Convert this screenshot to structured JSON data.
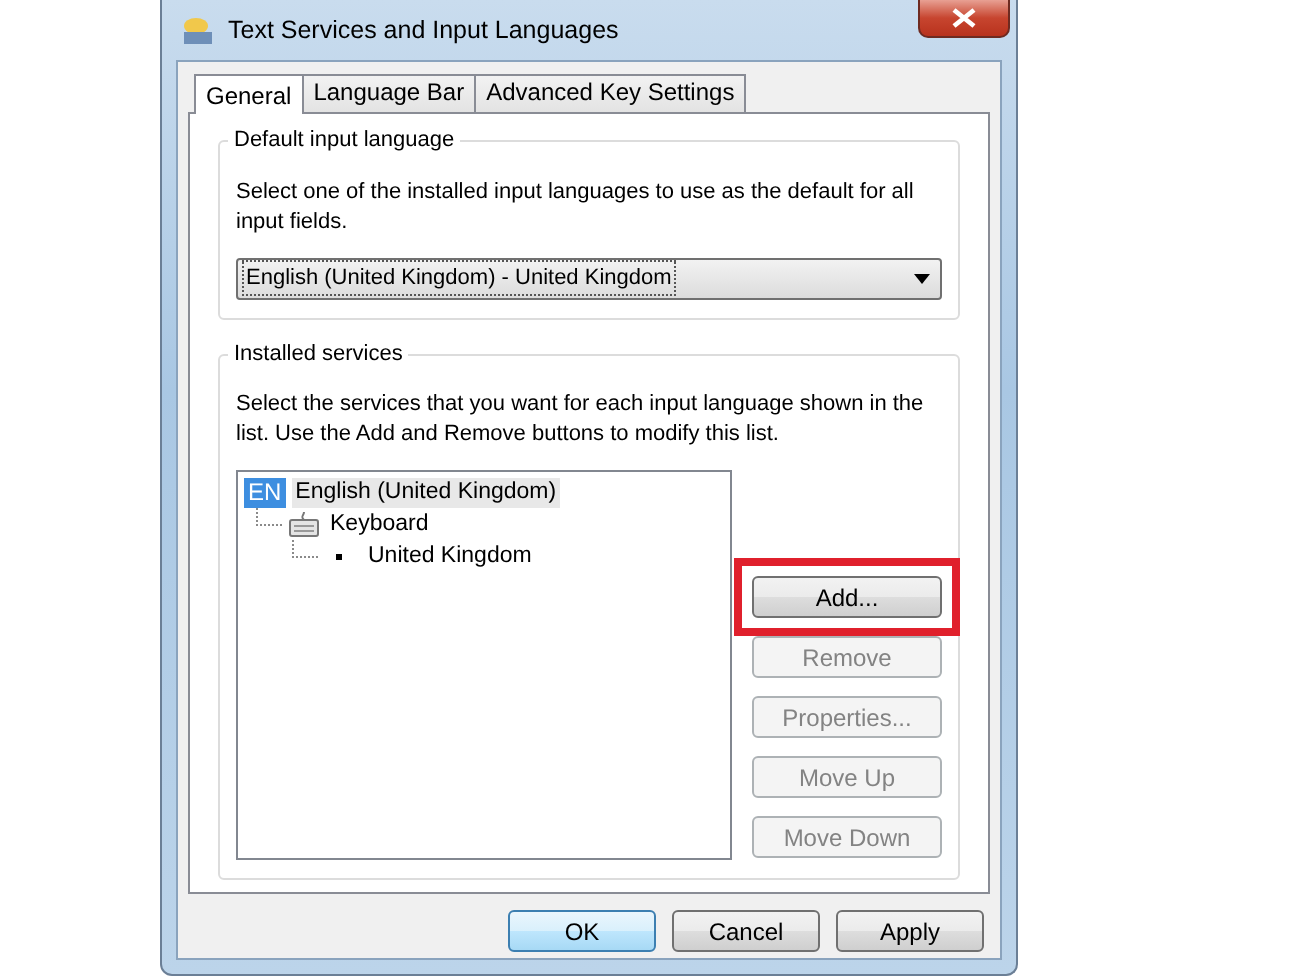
{
  "window": {
    "title": "Text Services and Input Languages"
  },
  "tabs": [
    {
      "label": "General",
      "selected": true
    },
    {
      "label": "Language Bar",
      "selected": false
    },
    {
      "label": "Advanced Key Settings",
      "selected": false
    }
  ],
  "default_input_language": {
    "legend": "Default input language",
    "description": "Select one of the installed input languages to use as the default for all input fields.",
    "dropdown": {
      "value": "English (United Kingdom) - United Kingdom"
    }
  },
  "installed_services": {
    "legend": "Installed services",
    "description": "Select the services that you want for each input language shown in the list. Use the Add and Remove buttons to modify this list.",
    "tree": [
      {
        "kind": "language",
        "badge": "EN",
        "label": "English (United Kingdom)",
        "selected": true,
        "children": [
          {
            "kind": "keyboard",
            "label": "Keyboard",
            "selected": false,
            "children": [
              {
                "kind": "layout",
                "label": "United Kingdom",
                "selected": false
              }
            ]
          }
        ]
      }
    ],
    "buttons": [
      {
        "label": "Add...",
        "disabled": false,
        "highlighted": true
      },
      {
        "label": "Remove",
        "disabled": true,
        "highlighted": false
      },
      {
        "label": "Properties...",
        "disabled": true,
        "highlighted": false
      },
      {
        "label": "Move Up",
        "disabled": true,
        "highlighted": false
      },
      {
        "label": "Move Down",
        "disabled": true,
        "highlighted": false
      }
    ]
  },
  "footer_buttons": [
    {
      "label": "OK",
      "default": true
    },
    {
      "label": "Cancel",
      "default": false
    },
    {
      "label": "Apply",
      "default": false
    }
  ]
}
